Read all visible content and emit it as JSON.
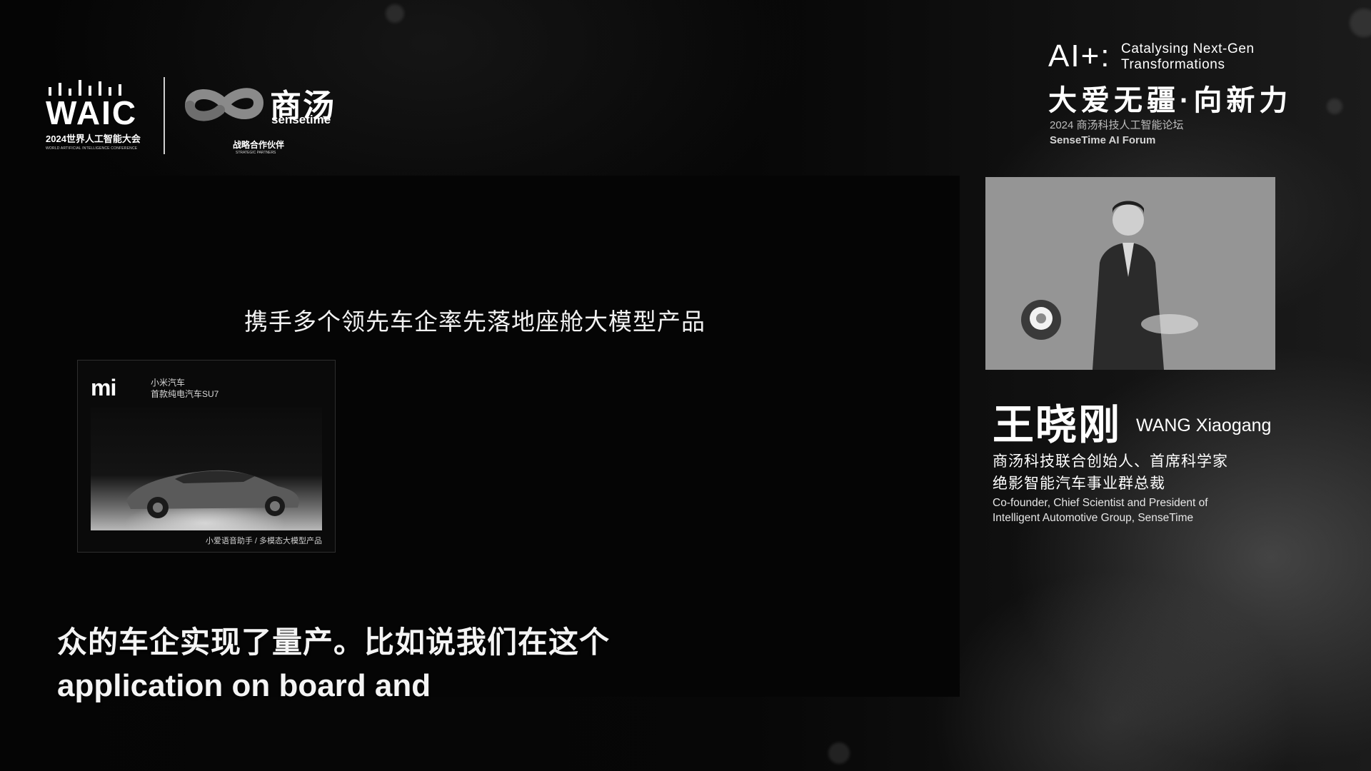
{
  "event": {
    "waic_wordmark": "WAIC",
    "waic_subtitle": "2024世界人工智能大会",
    "waic_subtitle_en": "WORLD ARTIFICIAL INTELLIGENCE CONFERENCE",
    "partner_name_cn": "商汤",
    "partner_name_en": "sensetime",
    "partner_label_cn": "战略合作伙伴",
    "partner_label_en": "STRATEGIC PARTNERS"
  },
  "forum": {
    "ai_plus": "AI+:",
    "tagline_line1": "Catalysing Next-Gen",
    "tagline_line2": "Transformations",
    "headline": "大爱无疆·向新力",
    "name_cn": "2024 商汤科技人工智能论坛",
    "name_en": "SenseTime AI Forum"
  },
  "slide": {
    "title": "携手多个领先车企率先落地座舱大模型产品",
    "card": {
      "brand_logo": "mi",
      "line1": "小米汽车",
      "line2": "首款纯电汽车SU7",
      "caption": "小爱语音助手 / 多模态大模型产品"
    }
  },
  "subtitles": {
    "cn": "众的车企实现了量产。比如说我们在这个",
    "en": "application on board and"
  },
  "speaker": {
    "name_cn": "王晓刚",
    "name_en": "WANG Xiaogang",
    "title_cn_1": "商汤科技联合创始人、首席科学家",
    "title_cn_2": "绝影智能汽车事业群总裁",
    "title_en_1": "Co-founder, Chief Scientist and President of",
    "title_en_2": "Intelligent Automotive Group, SenseTime"
  }
}
